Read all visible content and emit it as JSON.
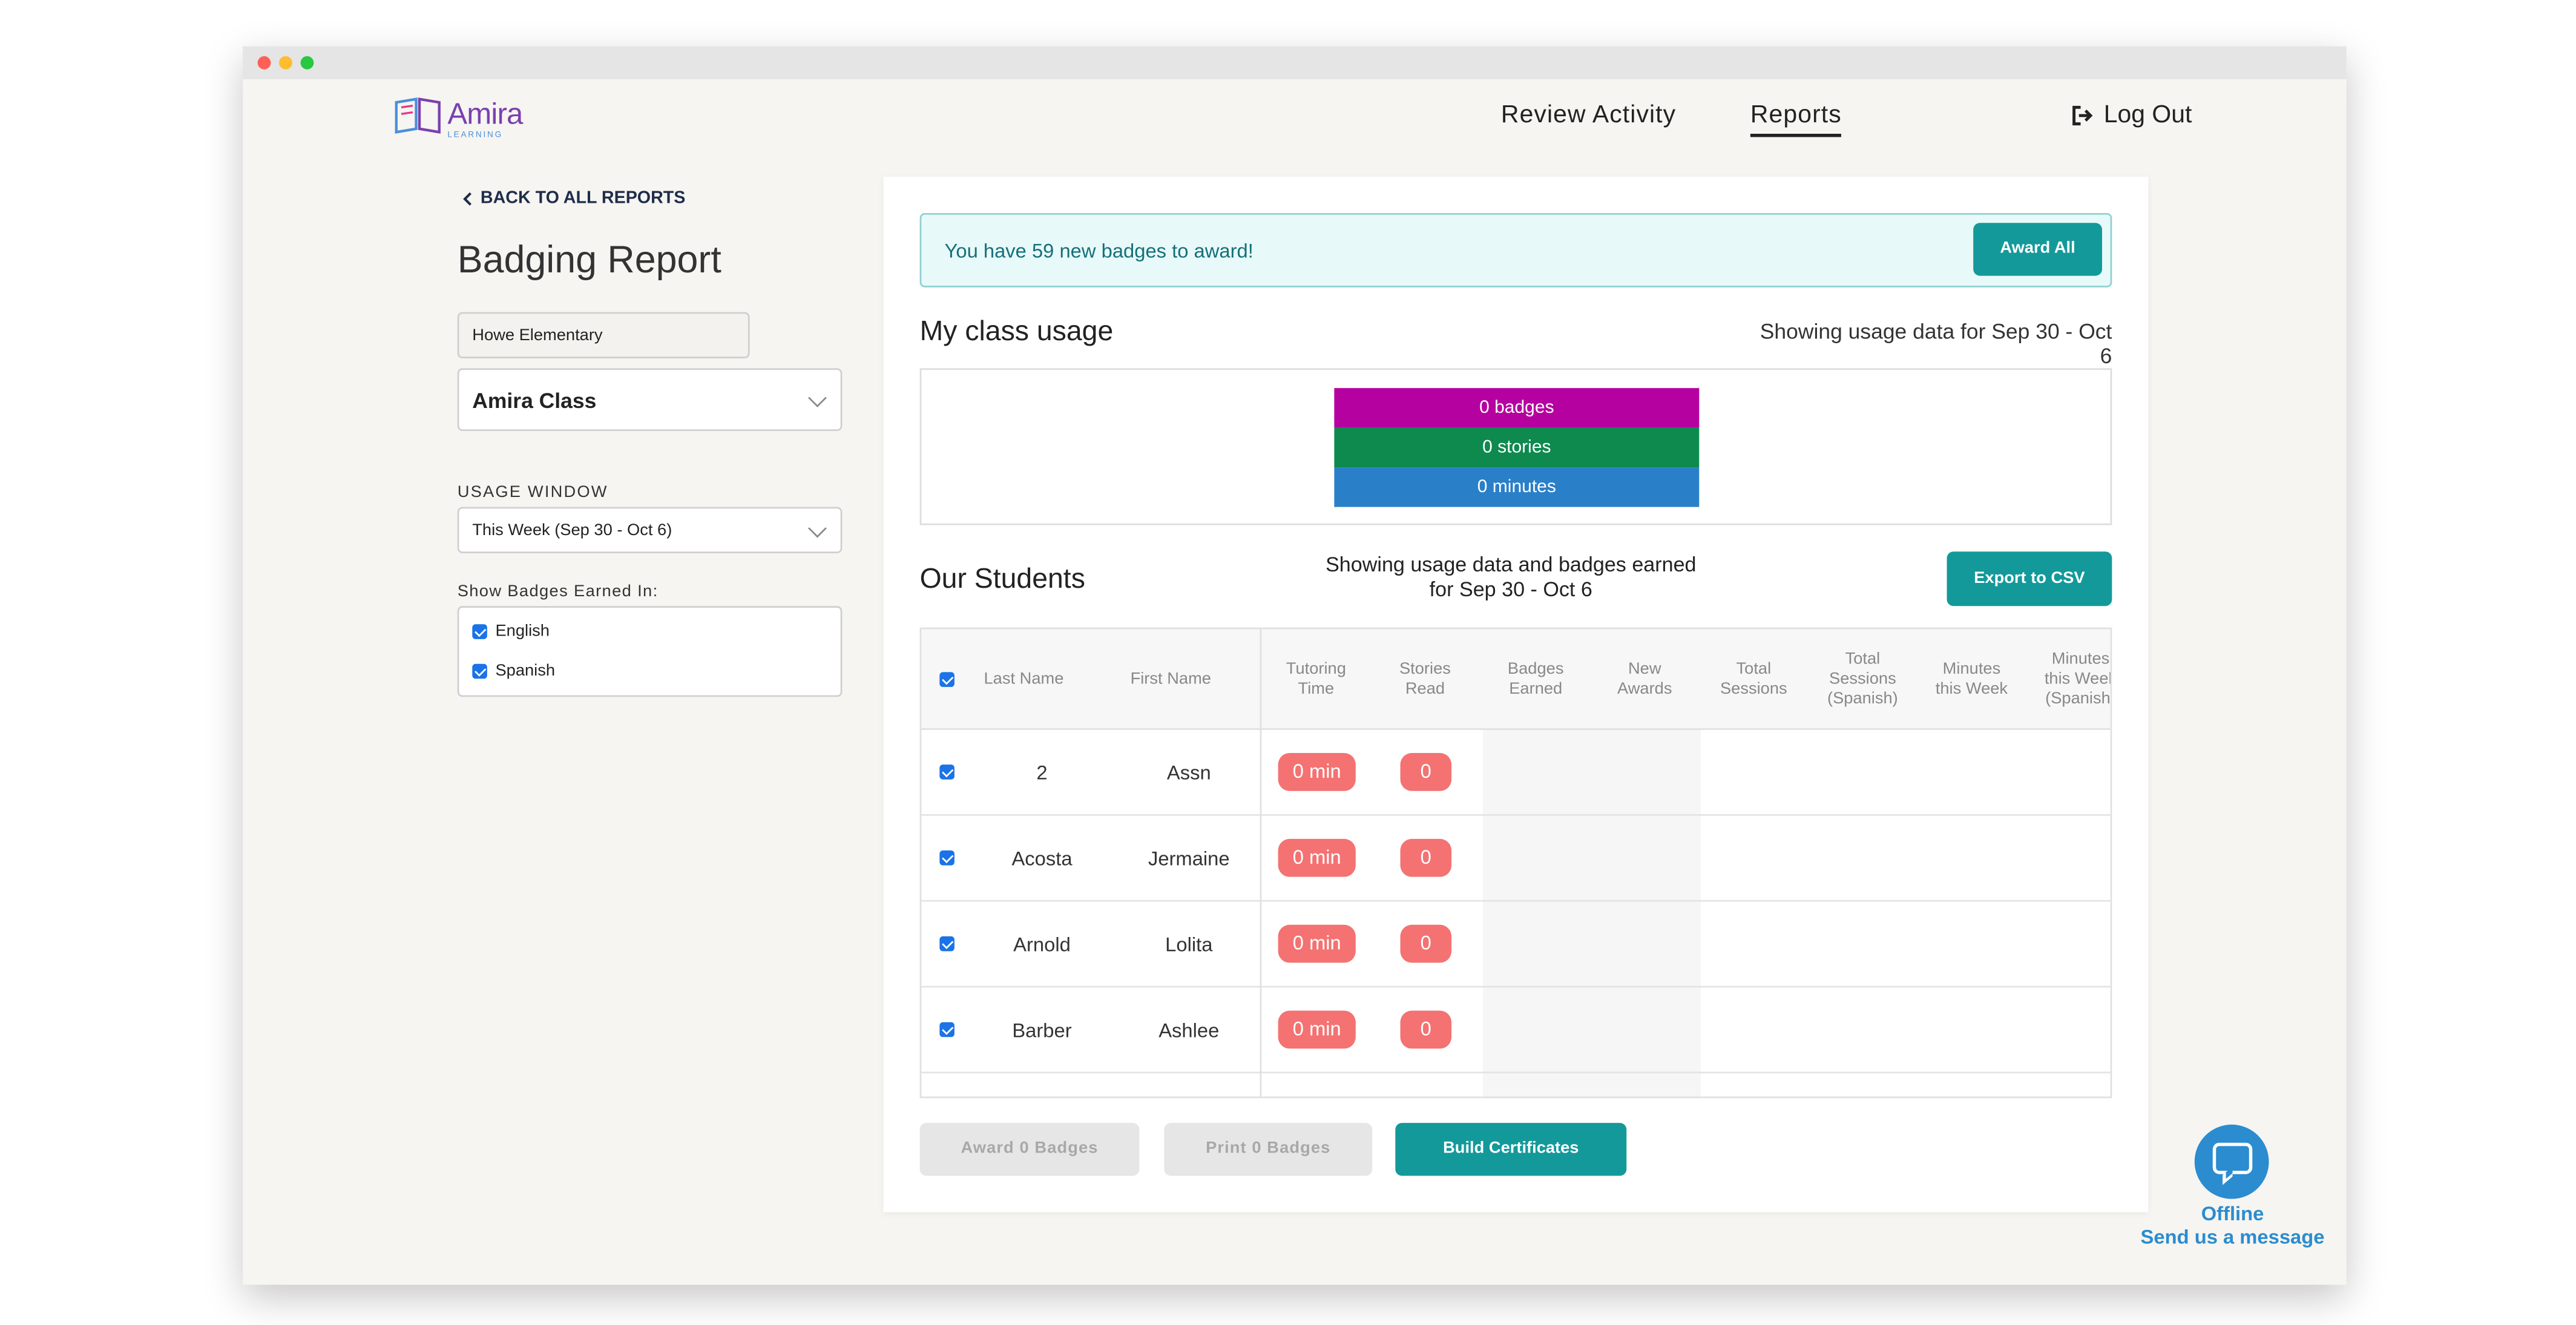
{
  "app": {
    "logo_text": "Amira",
    "logo_sub": "LEARNING"
  },
  "nav": {
    "review_activity": "Review Activity",
    "reports": "Reports",
    "logout": "Log Out"
  },
  "sidebar": {
    "back_link": "BACK TO ALL REPORTS",
    "title": "Badging Report",
    "school": "Howe Elementary",
    "class": "Amira Class",
    "usage_window_label": "USAGE WINDOW",
    "usage_window_value": "This Week (Sep 30 - Oct 6)",
    "badges_label": "Show Badges Earned In:",
    "languages": [
      {
        "label": "English",
        "checked": true
      },
      {
        "label": "Spanish",
        "checked": true
      }
    ]
  },
  "banner": {
    "text": "You have 59 new badges to award!",
    "award_all": "Award All"
  },
  "usage": {
    "title": "My class usage",
    "note": "Showing usage data for Sep 30 - Oct 6",
    "bars": [
      {
        "label": "0 badges",
        "color": "#b5019f"
      },
      {
        "label": "0 stories",
        "color": "#0e8a4f"
      },
      {
        "label": "0 minutes",
        "color": "#2a7fc9"
      }
    ]
  },
  "students": {
    "title": "Our Students",
    "note_line1": "Showing usage data and badges earned",
    "note_line2": "for Sep 30 - Oct 6",
    "export": "Export to CSV",
    "headers": {
      "last_name": "Last Name",
      "first_name": "First Name",
      "tutoring_time": [
        "Tutoring",
        "Time"
      ],
      "stories_read": [
        "Stories",
        "Read"
      ],
      "badges_earned": [
        "Badges",
        "Earned"
      ],
      "new_awards": [
        "New",
        "Awards"
      ],
      "total_sessions": [
        "Total",
        "Sessions"
      ],
      "total_sessions_spanish": [
        "Total",
        "Sessions",
        "(Spanish)"
      ],
      "minutes_week": [
        "Minutes",
        "this Week"
      ],
      "minutes_week_spanish": [
        "Minutes",
        "this Week",
        "(Spanish)"
      ]
    },
    "rows": [
      {
        "last": "2",
        "first": "Assn",
        "time": "0 min",
        "stories": "0"
      },
      {
        "last": "Acosta",
        "first": "Jermaine",
        "time": "0 min",
        "stories": "0"
      },
      {
        "last": "Arnold",
        "first": "Lolita",
        "time": "0 min",
        "stories": "0"
      },
      {
        "last": "Barber",
        "first": "Ashlee",
        "time": "0 min",
        "stories": "0"
      }
    ]
  },
  "footer_buttons": {
    "award": "Award 0 Badges",
    "print": "Print 0 Badges",
    "build": "Build Certificates"
  },
  "chat": {
    "status": "Offline",
    "message": "Send us a message"
  },
  "colors": {
    "teal": "#14999a",
    "pill": "#f47272",
    "chat": "#2b8ccf"
  }
}
